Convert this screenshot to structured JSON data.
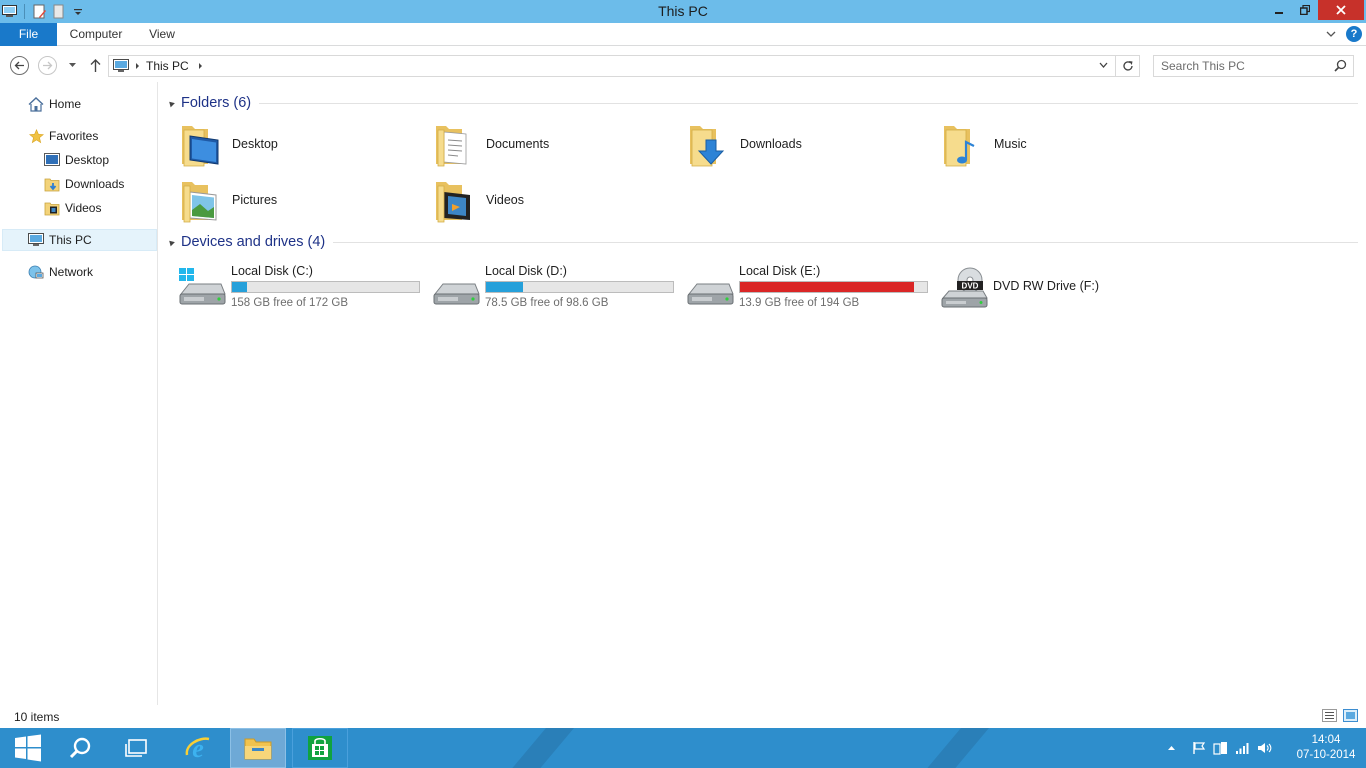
{
  "window": {
    "title": "This PC"
  },
  "ribbon": {
    "tabs": [
      "File",
      "Computer",
      "View"
    ]
  },
  "address": {
    "breadcrumb": [
      "This PC"
    ],
    "search_placeholder": "Search This PC"
  },
  "navpane": {
    "items": [
      {
        "label": "Home",
        "icon": "home-icon"
      },
      {
        "label": "Favorites",
        "icon": "star-icon"
      },
      {
        "label": "Desktop",
        "icon": "desktop-icon"
      },
      {
        "label": "Downloads",
        "icon": "downloads-folder-icon"
      },
      {
        "label": "Videos",
        "icon": "videos-folder-icon"
      },
      {
        "label": "This PC",
        "icon": "computer-icon",
        "selected": true
      },
      {
        "label": "Network",
        "icon": "network-icon"
      }
    ]
  },
  "folders": {
    "header": "Folders (6)",
    "items": [
      {
        "label": "Desktop",
        "icon": "desktop-folder-icon"
      },
      {
        "label": "Documents",
        "icon": "documents-folder-icon"
      },
      {
        "label": "Downloads",
        "icon": "downloads-folder-icon"
      },
      {
        "label": "Music",
        "icon": "music-folder-icon"
      },
      {
        "label": "Pictures",
        "icon": "pictures-folder-icon"
      },
      {
        "label": "Videos",
        "icon": "videos-folder-icon"
      }
    ]
  },
  "drives": {
    "header": "Devices and drives (4)",
    "items": [
      {
        "label": "Local Disk (C:)",
        "free_text": "158 GB free of 172 GB",
        "used_fraction": 0.08,
        "status": "normal",
        "color": "#26a0da",
        "icon": "system-drive-icon"
      },
      {
        "label": "Local Disk (D:)",
        "free_text": "78.5 GB free of 98.6 GB",
        "used_fraction": 0.2,
        "status": "normal",
        "color": "#26a0da",
        "icon": "hard-drive-icon"
      },
      {
        "label": "Local Disk (E:)",
        "free_text": "13.9 GB free of 194 GB",
        "used_fraction": 0.93,
        "status": "full",
        "color": "#da2626",
        "icon": "hard-drive-icon"
      },
      {
        "label": "DVD RW Drive (F:)",
        "icon": "dvd-drive-icon",
        "disc_label": "DVD"
      }
    ]
  },
  "statusbar": {
    "count": "10 items"
  },
  "taskbar": {
    "clock_time": "14:04",
    "clock_date": "07-10-2014",
    "items": [
      "start-button",
      "search",
      "task-view",
      "internet-explorer",
      "file-explorer",
      "store"
    ]
  },
  "colors": {
    "titlebar": "#6cbcea",
    "file_tab": "#1979ca",
    "taskbar": "#2e8ecc",
    "close": "#c7312a"
  }
}
